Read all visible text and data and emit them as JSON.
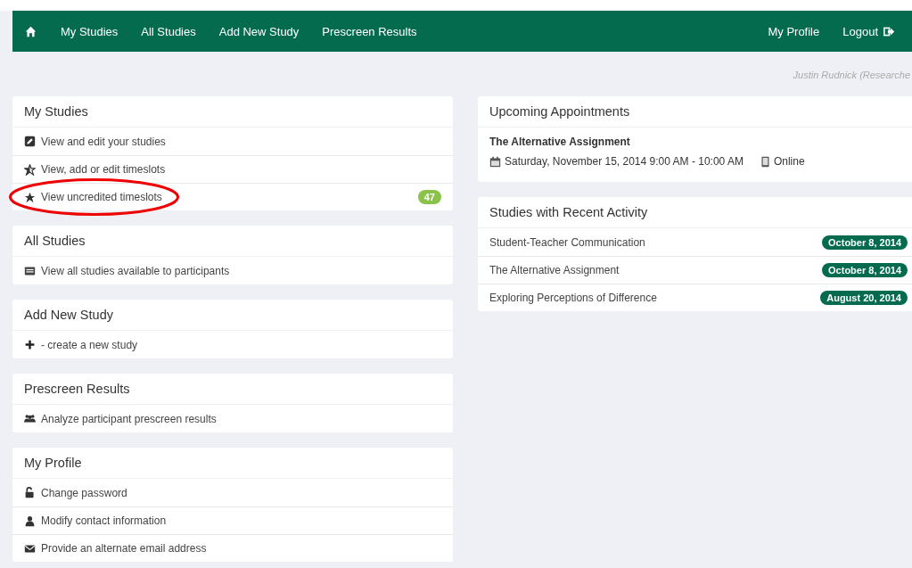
{
  "navbar": {
    "left_items": [
      "My Studies",
      "All Studies",
      "Add New Study",
      "Prescreen Results"
    ],
    "right_items": [
      "My Profile",
      "Logout"
    ]
  },
  "user_line": "Justin Rudnick (Researche",
  "left_panels": [
    {
      "title": "My Studies",
      "items": [
        {
          "label": "View and edit your studies"
        },
        {
          "label": "View, add or edit timeslots"
        },
        {
          "label": "View uncredited timeslots",
          "badge": "47",
          "circled": true
        }
      ]
    },
    {
      "title": "All Studies",
      "items": [
        {
          "label": "View all studies available to participants"
        }
      ]
    },
    {
      "title": "Add New Study",
      "items": [
        {
          "label": "- create a new study"
        }
      ]
    },
    {
      "title": "Prescreen Results",
      "items": [
        {
          "label": "Analyze participant prescreen results"
        }
      ]
    },
    {
      "title": "My Profile",
      "items": [
        {
          "label": "Change password"
        },
        {
          "label": "Modify contact information"
        },
        {
          "label": "Provide an alternate email address"
        }
      ]
    }
  ],
  "appointments": {
    "title": "Upcoming Appointments",
    "study": "The Alternative Assignment",
    "when": "Saturday, November 15, 2014 9:00 AM - 10:00 AM",
    "location": "Online"
  },
  "recent_activity": {
    "title": "Studies with Recent Activity",
    "rows": [
      {
        "study": "Student-Teacher Communication",
        "date": "October 8, 2014"
      },
      {
        "study": "The Alternative Assignment",
        "date": "October 8, 2014"
      },
      {
        "study": "Exploring Perceptions of Difference",
        "date": "August 20, 2014"
      }
    ]
  }
}
